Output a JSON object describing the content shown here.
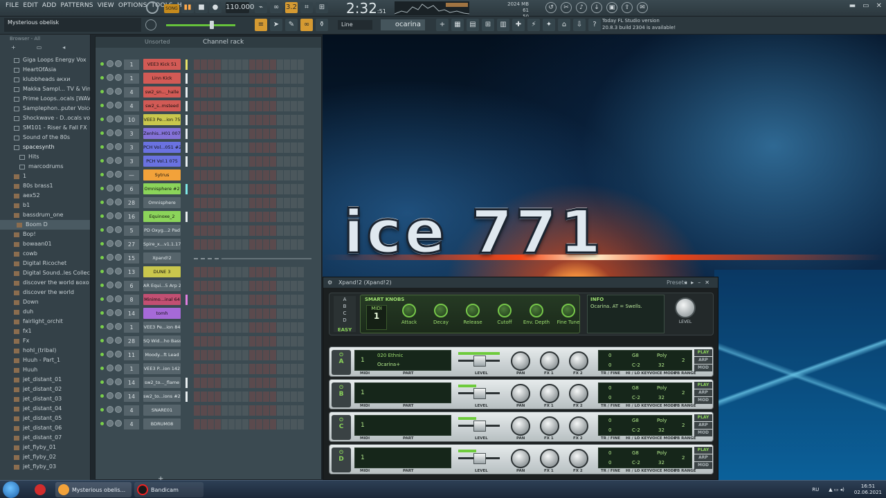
{
  "menu": [
    "FILE",
    "EDIT",
    "ADD",
    "PATTERNS",
    "VIEW",
    "OPTIONS",
    "TOOLS",
    "HELP"
  ],
  "transport": {
    "song_label": "SONG",
    "tempo": "110.000",
    "time": "2:32",
    "time_sub": ":51",
    "time_small": "B:S:T",
    "step_label": "3.2"
  },
  "monitor": {
    "memory": "2024 MB",
    "cpu": "61",
    "poly": "50"
  },
  "hint_bar": "Mysterious obelisk",
  "snap": "Line",
  "pattern_name": "ocarina",
  "news": {
    "line1": "Today   FL Studio version",
    "line2": "20.8.3 build 2304 is available!"
  },
  "browser": {
    "header": "Browser - All",
    "items": [
      {
        "label": "Giga Loops Energy Vox",
        "kind": "folder"
      },
      {
        "label": "HeartOfAsia",
        "kind": "folder"
      },
      {
        "label": "klubbheads акхи",
        "kind": "folder"
      },
      {
        "label": "Makka Sampl... TV & Vinyl",
        "kind": "folder"
      },
      {
        "label": "Prime Loops..ocals [WAV]",
        "kind": "folder"
      },
      {
        "label": "Samplephon..puter Voices",
        "kind": "folder"
      },
      {
        "label": "Shockwave - D..ocals vol 2",
        "kind": "folder"
      },
      {
        "label": "SM101 - Riser & Fall FX",
        "kind": "folder"
      },
      {
        "label": "Sound of the 80s",
        "kind": "folder"
      },
      {
        "label": "spacesynth",
        "kind": "open"
      },
      {
        "label": "Hits",
        "kind": "sub"
      },
      {
        "label": "marcodrums",
        "kind": "sub"
      },
      {
        "label": "1",
        "kind": "file"
      },
      {
        "label": "80s brass1",
        "kind": "file"
      },
      {
        "label": "aex52",
        "kind": "file"
      },
      {
        "label": "b1",
        "kind": "file"
      },
      {
        "label": "bassdrum_one",
        "kind": "file"
      },
      {
        "label": "Boom D",
        "kind": "sel"
      },
      {
        "label": "Bop!",
        "kind": "file"
      },
      {
        "label": "bowaan01",
        "kind": "file"
      },
      {
        "label": "cowb",
        "kind": "file"
      },
      {
        "label": "Digital Ricochet",
        "kind": "file"
      },
      {
        "label": "Digital Sound..les Collection",
        "kind": "file"
      },
      {
        "label": "discover the world вохо",
        "kind": "file"
      },
      {
        "label": "discover the world",
        "kind": "file"
      },
      {
        "label": "Down",
        "kind": "file"
      },
      {
        "label": "duh",
        "kind": "file"
      },
      {
        "label": "fairlight_orchit",
        "kind": "file"
      },
      {
        "label": "fx1",
        "kind": "file"
      },
      {
        "label": "Fx",
        "kind": "file"
      },
      {
        "label": "hohl_(tribal)",
        "kind": "file"
      },
      {
        "label": "Huuh - Part_1",
        "kind": "file"
      },
      {
        "label": "Huuh",
        "kind": "file"
      },
      {
        "label": "jet_distant_01",
        "kind": "file"
      },
      {
        "label": "jet_distant_02",
        "kind": "file"
      },
      {
        "label": "jet_distant_03",
        "kind": "file"
      },
      {
        "label": "jet_distant_04",
        "kind": "file"
      },
      {
        "label": "jet_distant_05",
        "kind": "file"
      },
      {
        "label": "jet_distant_06",
        "kind": "file"
      },
      {
        "label": "jet_distant_07",
        "kind": "file"
      },
      {
        "label": "jet_flyby_01",
        "kind": "file"
      },
      {
        "label": "jet_flyby_02",
        "kind": "file"
      },
      {
        "label": "jet_flyby_03",
        "kind": "file"
      }
    ]
  },
  "rack": {
    "title": "Channel rack",
    "filter": "Unsorted",
    "channels": [
      {
        "num": "1",
        "name": "VEE3 Kick 51",
        "color": "#d25a55",
        "bar": "#e8e36a"
      },
      {
        "num": "1",
        "name": "Linn Kick",
        "color": "#d25a55",
        "bar": "#e8eef0"
      },
      {
        "num": "4",
        "name": "sw2_sn..._halle",
        "color": "#d25a55",
        "bar": "#e8eef0"
      },
      {
        "num": "4",
        "name": "sw2_s..msteed",
        "color": "#d25a55",
        "bar": "#e8eef0"
      },
      {
        "num": "10",
        "name": "VEE3 Pe...ion 75",
        "color": "#c9c74d",
        "bar": "#e8eef0"
      },
      {
        "num": "3",
        "name": "Zenhis..H01 007",
        "color": "#8472d8",
        "bar": "#e8eef0"
      },
      {
        "num": "3",
        "name": "PCH Vol...051 #2",
        "color": "#6a72e0",
        "bar": "#e8eef0"
      },
      {
        "num": "3",
        "name": "PCH Vol.1 075",
        "color": "#6a72e0",
        "bar": "#e8eef0"
      },
      {
        "num": "—",
        "name": "Sytrus",
        "color": "#f2a23a",
        "bar": "none"
      },
      {
        "num": "6",
        "name": "Omnisphere #2",
        "color": "#8bd45a",
        "bar": "#7fe8e8"
      },
      {
        "num": "28",
        "name": "Omnisphere",
        "color": "#56646b",
        "bar": "none"
      },
      {
        "num": "16",
        "name": "Equinoxe_2",
        "color": "#8bd45a",
        "bar": "#e8eef0"
      },
      {
        "num": "5",
        "name": "PD Oxyg...2 Pad",
        "color": "#56646b",
        "bar": "none"
      },
      {
        "num": "27",
        "name": "Spire_x...v1.1.17",
        "color": "#56646b",
        "bar": "none"
      },
      {
        "num": "15",
        "name": "Xpand!2",
        "color": "#56646b",
        "bar": "none"
      },
      {
        "num": "13",
        "name": "DUNE 3",
        "color": "#c9c74d",
        "bar": "none"
      },
      {
        "num": "6",
        "name": "AR Equi...5 Arp 2",
        "color": "#56646b",
        "bar": "none"
      },
      {
        "num": "8",
        "name": "Minimo...inal 64",
        "color": "#c24f72",
        "bar": "#e080e0"
      },
      {
        "num": "14",
        "name": "tomh",
        "color": "#a66ad8",
        "bar": "none"
      },
      {
        "num": "1",
        "name": "VEE3 Pe...ion 84",
        "color": "#56646b",
        "bar": "none"
      },
      {
        "num": "28",
        "name": "SQ Wid...ho Bass",
        "color": "#56646b",
        "bar": "none"
      },
      {
        "num": "11",
        "name": "Moody...ft Lead",
        "color": "#56646b",
        "bar": "none"
      },
      {
        "num": "1",
        "name": "VEE3 P...ion 142",
        "color": "#56646b",
        "bar": "none"
      },
      {
        "num": "14",
        "name": "sw2_to..._flame",
        "color": "#56646b",
        "bar": "#e8eef0"
      },
      {
        "num": "14",
        "name": "sw2_to...ions #2",
        "color": "#56646b",
        "bar": "#e8eef0"
      },
      {
        "num": "4",
        "name": "SNARE01",
        "color": "#56646b",
        "bar": "none"
      },
      {
        "num": "4",
        "name": "BDRUM08",
        "color": "#56646b",
        "bar": "none"
      }
    ],
    "add_label": "+"
  },
  "artwork_text": "ice 771",
  "plugin": {
    "title": "Xpand!2 (Xpand!2)",
    "presets_label": "Presets",
    "easy": "EASY",
    "smart_knobs_label": "SMART KNOBS",
    "midi_label": "MIDI",
    "midi_value": "1",
    "knobs": [
      "Attack",
      "Decay",
      "Release",
      "Cutoff",
      "Env. Depth",
      "Fine Tune"
    ],
    "info_label": "INFO",
    "info_text": "Ocarina. AT = Swells.",
    "level_label": "LEVEL",
    "parts": [
      {
        "letter": "A",
        "midi": "1",
        "line1": "020 Ethnic",
        "line2": "Ocarina+",
        "tr": "0",
        "fine": "0",
        "hi": "G8",
        "lo": "C-2",
        "voice": "Poly",
        "count": "32",
        "pb": "2"
      },
      {
        "letter": "B",
        "midi": "1",
        "line1": "",
        "line2": "",
        "tr": "0",
        "fine": "0",
        "hi": "G8",
        "lo": "C-2",
        "voice": "Poly",
        "count": "32",
        "pb": "2"
      },
      {
        "letter": "C",
        "midi": "1",
        "line1": "",
        "line2": "",
        "tr": "0",
        "fine": "0",
        "hi": "G8",
        "lo": "C-2",
        "voice": "Poly",
        "count": "32",
        "pb": "2"
      },
      {
        "letter": "D",
        "midi": "1",
        "line1": "",
        "line2": "",
        "tr": "0",
        "fine": "0",
        "hi": "G8",
        "lo": "C-2",
        "voice": "Poly",
        "count": "32",
        "pb": "2"
      }
    ],
    "part_labels": {
      "midi": "MIDI",
      "part": "PART",
      "level": "LEVEL",
      "pan": "PAN",
      "fx1": "FX 1",
      "fx2": "FX 2",
      "tr": "TR / FINE",
      "key": "HI / LO KEY",
      "voice": "VOICE MODE",
      "pb": "PB RANGE"
    },
    "modes": [
      "PLAY",
      "ARP",
      "MOD"
    ]
  },
  "taskbar": {
    "apps": [
      "Mysterious obelis...",
      "Bandicam"
    ],
    "lang": "RU",
    "time": "16:51",
    "date": "02.06.2021"
  }
}
